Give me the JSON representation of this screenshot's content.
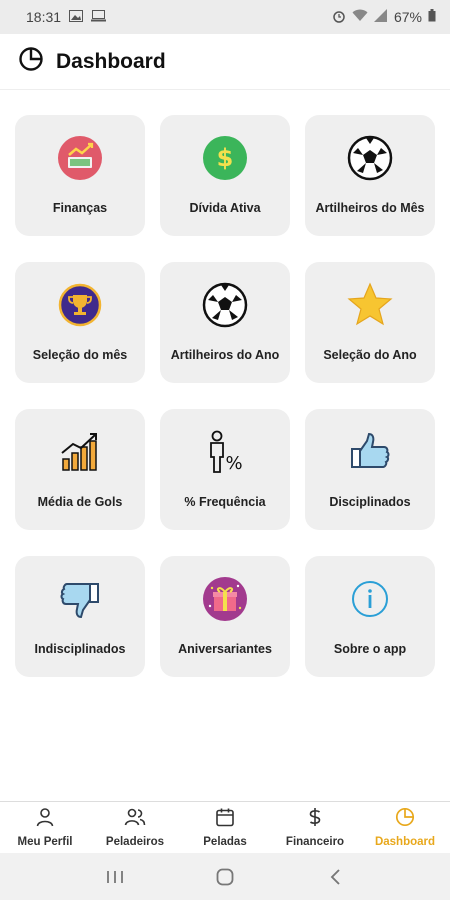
{
  "status_bar": {
    "time": "18:31",
    "battery": "67%"
  },
  "header": {
    "title": "Dashboard"
  },
  "tiles": [
    {
      "label": "Finanças",
      "icon": "finance-chart-icon"
    },
    {
      "label": "Dívida Ativa",
      "icon": "dollar-coin-icon"
    },
    {
      "label": "Artilheiros do Mês",
      "icon": "soccer-ball-icon"
    },
    {
      "label": "Seleção do mês",
      "icon": "trophy-icon"
    },
    {
      "label": "Artilheiros do Ano",
      "icon": "soccer-ball-icon"
    },
    {
      "label": "Seleção do Ano",
      "icon": "star-icon"
    },
    {
      "label": "Média de Gols",
      "icon": "bar-chart-growth-icon"
    },
    {
      "label": "% Frequência",
      "icon": "person-percent-icon"
    },
    {
      "label": "Disciplinados",
      "icon": "thumbs-up-icon"
    },
    {
      "label": "Indisciplinados",
      "icon": "thumbs-down-icon"
    },
    {
      "label": "Aniversariantes",
      "icon": "gift-icon"
    },
    {
      "label": "Sobre o app",
      "icon": "info-icon"
    }
  ],
  "bottom_nav": [
    {
      "label": "Meu Perfil",
      "icon": "user-icon"
    },
    {
      "label": "Peladeiros",
      "icon": "users-icon"
    },
    {
      "label": "Peladas",
      "icon": "calendar-icon"
    },
    {
      "label": "Financeiro",
      "icon": "dollar-icon"
    },
    {
      "label": "Dashboard",
      "icon": "pie-chart-icon",
      "active": true
    }
  ],
  "colors": {
    "accent": "#e8a81c",
    "tile_bg": "#efefef"
  }
}
